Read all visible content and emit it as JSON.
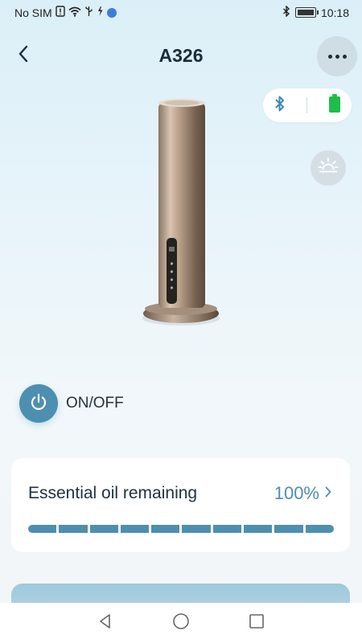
{
  "status_bar": {
    "carrier": "No SIM",
    "time": "10:18",
    "icons": [
      "sim-alert-icon",
      "wifi-icon",
      "usb-icon",
      "charging-icon",
      "globe-icon",
      "bluetooth-icon",
      "battery-icon"
    ]
  },
  "header": {
    "title": "A326",
    "back_icon": "chevron-left-icon",
    "more_icon": "more-horizontal-icon"
  },
  "connection": {
    "bluetooth_icon": "bluetooth-icon",
    "battery_icon": "battery-full-icon",
    "bluetooth_color": "#3f86b0",
    "battery_color": "#1dbf4a"
  },
  "light_toggle_icon": "sun-icon",
  "power": {
    "label": "ON/OFF",
    "icon": "power-icon",
    "accent": "#4d8fb0"
  },
  "oil": {
    "title": "Essential oil remaining",
    "value": "100%",
    "level_fraction": 1.0,
    "segments": 10,
    "color": "#4d8fb0"
  },
  "nav": {
    "back_icon": "nav-back-triangle-icon",
    "home_icon": "nav-home-circle-icon",
    "recents_icon": "nav-recents-square-icon"
  }
}
